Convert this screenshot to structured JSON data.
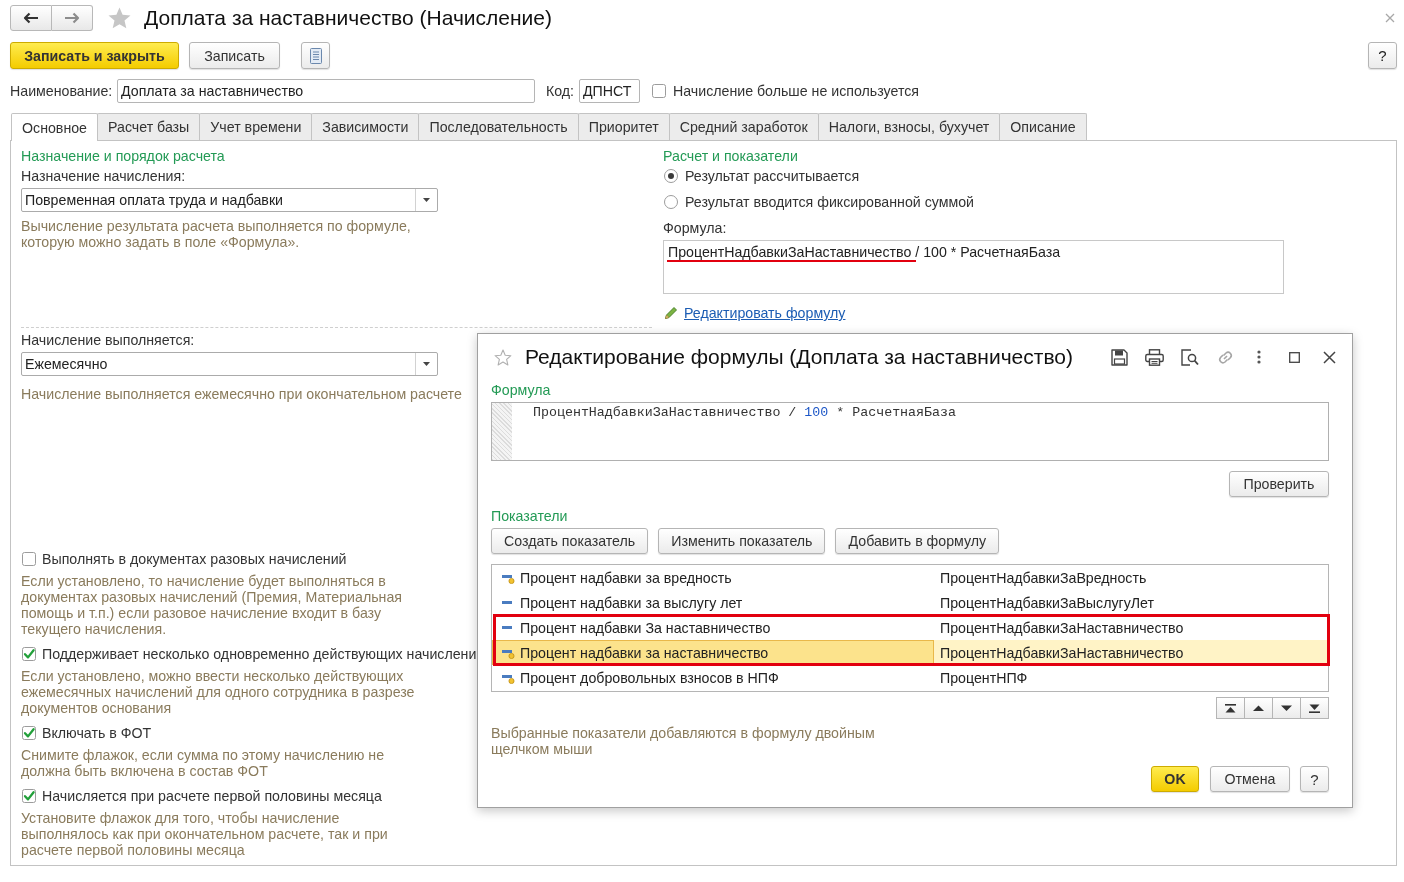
{
  "window": {
    "title": "Доплата за наставничество (Начисление)"
  },
  "toolbar": {
    "buttons": [
      {
        "label": "Записать и закрыть",
        "kind": "primary"
      },
      {
        "label": "Записать",
        "kind": "default"
      }
    ],
    "help": "?"
  },
  "header": {
    "name_label": "Наименование:",
    "name_value": "Доплата за наставничество",
    "code_label": "Код:",
    "code_value": "ДПНСТ",
    "unused_checkbox": {
      "label": "Начисление больше не используется",
      "checked": false
    }
  },
  "tabs": [
    {
      "label": "Основное",
      "selected": true
    },
    {
      "label": "Расчет базы",
      "selected": false
    },
    {
      "label": "Учет времени",
      "selected": false
    },
    {
      "label": "Зависимости",
      "selected": false
    },
    {
      "label": "Последовательность",
      "selected": false
    },
    {
      "label": "Приоритет",
      "selected": false
    },
    {
      "label": "Средний заработок",
      "selected": false
    },
    {
      "label": "Налоги, взносы, бухучет",
      "selected": false
    },
    {
      "label": "Описание",
      "selected": false
    }
  ],
  "main": {
    "purpose_group": {
      "title": "Назначение и порядок расчета",
      "label": "Назначение начисления:",
      "value": "Повременная оплата труда и надбавки",
      "hint": "Вычисление результата расчета выполняется по формуле, которую можно задать в поле «Формула»."
    },
    "calc_group": {
      "title": "Расчет и показатели",
      "options": [
        {
          "label": "Результат рассчитывается",
          "selected": true
        },
        {
          "label": "Результат вводится фиксированной суммой",
          "selected": false
        }
      ],
      "formula_label": "Формула:",
      "formula_parts": [
        {
          "text": "ПроцентНадбавкиЗаНаставничество",
          "underlined": true
        },
        {
          "text": "/ 100 * РасчетнаяБаза",
          "underlined": false
        }
      ],
      "edit_link": "Редактировать формулу"
    },
    "schedule_group": {
      "label": "Начисление выполняется:",
      "value": "Ежемесячно",
      "hint": "Начисление выполняется ежемесячно при окончательном расчете"
    },
    "options": [
      {
        "label": "Выполнять в документах разовых начислений",
        "checked": false,
        "hint": "Если установлено, то начисление будет выполняться в документах разовых начислений (Премия, Материальная помощь и т.п.) если разовое начисление входит в базу текущего начисления."
      },
      {
        "label": "Поддерживает несколько одновременно действующих начислени",
        "checked": true,
        "hint": "Если установлено, можно ввести несколько действующих ежемесячных начислений для одного сотрудника в разрезе документов основания"
      },
      {
        "label": "Включать в ФОТ",
        "checked": true,
        "hint": "Снимите флажок, если сумма по этому начислению не должна быть включена в состав ФОТ"
      },
      {
        "label": "Начисляется при расчете первой половины месяца",
        "checked": true,
        "hint": "Установите флажок для того, чтобы начисление выполнялось как при окончательном расчете, так и при расчете первой половины месяца"
      }
    ]
  },
  "dialog": {
    "title": "Редактирование формулы (Доплата за наставничество)",
    "formula_label": "Формула",
    "code_tokens": [
      {
        "text": "ПроцентНадбавкиЗаНаставничество",
        "kind": "identifier"
      },
      {
        "text": "/",
        "kind": "operator"
      },
      {
        "text": "100",
        "kind": "number"
      },
      {
        "text": "*",
        "kind": "operator"
      },
      {
        "text": "РасчетнаяБаза",
        "kind": "identifier"
      }
    ],
    "check_button": "Проверить",
    "indicators_label": "Показатели",
    "buttons": [
      "Создать показатель",
      "Изменить показатель",
      "Добавить в формулу"
    ],
    "rows": [
      {
        "name": "Процент надбавки за вредность",
        "identifier": "ПроцентНадбавкиЗаВредность",
        "kind": "badged",
        "selected": false,
        "highlighted": false
      },
      {
        "name": "Процент надбавки за выслугу лет",
        "identifier": "ПроцентНадбавкиЗаВыслугуЛет",
        "kind": "plain",
        "selected": false,
        "highlighted": false
      },
      {
        "name": "Процент надбавки За наставничество",
        "identifier": "ПроцентНадбавкиЗаНаставничество",
        "kind": "plain",
        "selected": false,
        "highlighted": true
      },
      {
        "name": "Процент надбавки за наставничество",
        "identifier": "ПроцентНадбавкиЗаНаставничество",
        "kind": "badged",
        "selected": true,
        "highlighted": true
      },
      {
        "name": "Процент добровольных взносов в НПФ",
        "identifier": "ПроцентНПФ",
        "kind": "badged",
        "selected": false,
        "highlighted": false
      }
    ],
    "hint": "Выбранные показатели добавляются в формулу двойным щелчком мыши",
    "footer_buttons": [
      {
        "label": "OK",
        "kind": "primary"
      },
      {
        "label": "Отмена",
        "kind": "default"
      },
      {
        "label": "?",
        "kind": "default"
      }
    ]
  }
}
